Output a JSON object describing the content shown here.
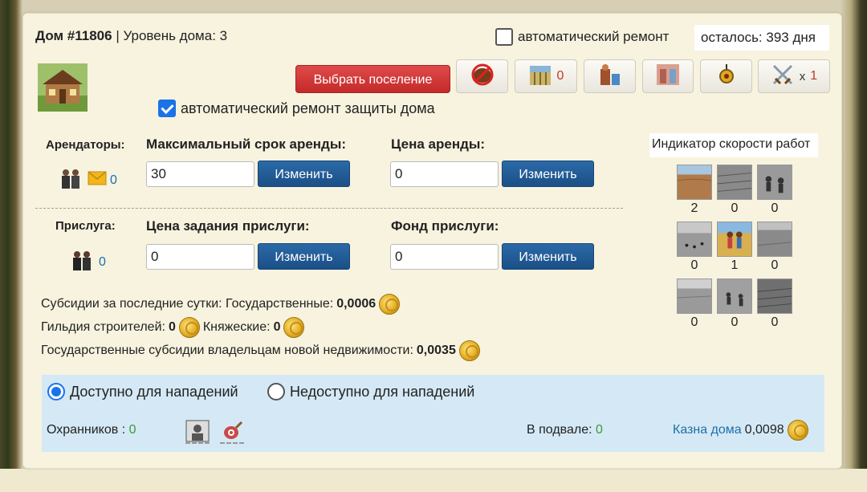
{
  "header": {
    "house_title": "Дом #11806",
    "separator": "|",
    "level_label": "Уровень дома: 3",
    "auto_repair_label": "автоматический ремонт",
    "remaining": "осталось: 393 дня"
  },
  "toolbar": {
    "select_settlement_label": "Выбрать поселение",
    "buttons": [
      {
        "icon": "no-pests-icon",
        "count": ""
      },
      {
        "icon": "grain-field-icon",
        "count": "0"
      },
      {
        "icon": "workshop-icon",
        "count": ""
      },
      {
        "icon": "building-icon",
        "count": ""
      },
      {
        "icon": "amulet-icon",
        "count": ""
      },
      {
        "icon": "crossed-swords-icon",
        "prefix": "x",
        "count": "1"
      }
    ]
  },
  "auto_defense_repair": {
    "label": "автоматический ремонт защиты дома",
    "checked": true
  },
  "tenants": {
    "label": "Арендаторы:",
    "count": "0",
    "max_term_label": "Максимальный срок аренды:",
    "max_term_value": "30",
    "rent_price_label": "Цена аренды:",
    "rent_price_value": "0",
    "change_label": "Изменить"
  },
  "servants": {
    "label": "Прислуга:",
    "count": "0",
    "task_price_label": "Цена задания прислуги:",
    "task_price_value": "0",
    "fund_label": "Фонд прислуги:",
    "fund_value": "0",
    "change_label": "Изменить"
  },
  "speed_indicator": {
    "title": "Индикатор скорости работ",
    "tiles": [
      {
        "icon": "plowed-field-icon",
        "value": "2"
      },
      {
        "icon": "furrow-field-icon",
        "value": "0"
      },
      {
        "icon": "farmers-icon",
        "value": "0"
      },
      {
        "icon": "birds-field-icon",
        "value": "0"
      },
      {
        "icon": "couple-farmers-icon",
        "value": "1"
      },
      {
        "icon": "grass-field-icon",
        "value": "0"
      },
      {
        "icon": "crop-field-icon",
        "value": "0"
      },
      {
        "icon": "workers-field-icon",
        "value": "0"
      },
      {
        "icon": "rows-field-icon",
        "value": "0"
      }
    ]
  },
  "subsidies": {
    "line1_prefix": "Субсидии за последние сутки: Государственные:",
    "line1_value": "0,0006",
    "guild_label": "Гильдия строителей:",
    "guild_value": "0",
    "princely_label": "Княжеские:",
    "princely_value": "0",
    "new_property_label": "Государственные субсидии владельцам новой недвижимости:",
    "new_property_value": "0,0035"
  },
  "attack": {
    "available_label": "Доступно для нападений",
    "unavailable_label": "Недоступно для нападений",
    "selected": "available",
    "guards_label": "Охранников :",
    "guards_count": "0",
    "basement_label": "В подвале:",
    "basement_count": "0",
    "treasury_label": "Казна дома",
    "treasury_value": "0,0098"
  },
  "colors": {
    "accent_red": "#c42a2a",
    "accent_blue": "#1b4f86",
    "count_blue": "#1a6fb0",
    "zone_blue": "#d4e9f5",
    "green": "#3a9a3a"
  }
}
